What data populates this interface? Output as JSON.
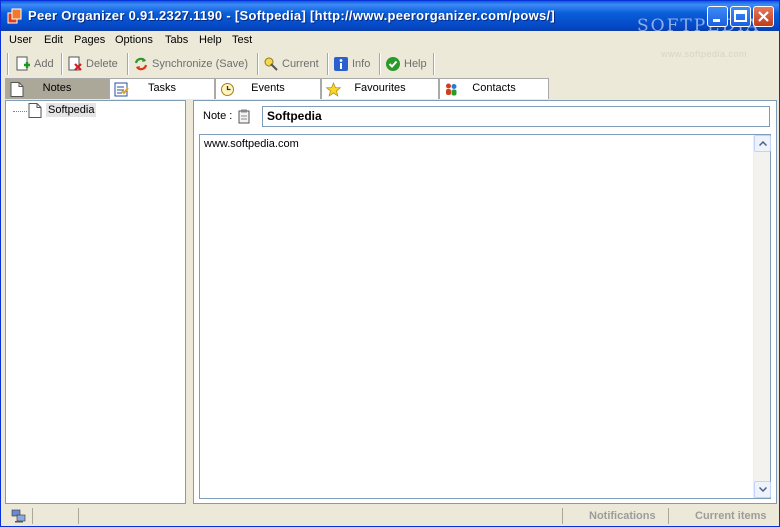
{
  "window": {
    "title": "Peer Organizer 0.91.2327.1190 - [Softpedia] [http://www.peerorganizer.com/pows/]",
    "watermark": "SOFTPEDIA",
    "watermark_sub": "www.softpedia.com",
    "controls": [
      "minimize",
      "maximize",
      "close"
    ]
  },
  "menu": {
    "items": [
      "User",
      "Edit",
      "Pages",
      "Options",
      "Tabs",
      "Help",
      "Test"
    ]
  },
  "toolbar": {
    "add_label": "Add",
    "delete_label": "Delete",
    "sync_label": "Synchronize (Save)",
    "current_label": "Current",
    "info_label": "Info",
    "help_label": "Help"
  },
  "tabs": {
    "items": [
      {
        "label": "Notes",
        "icon": "note-icon",
        "active": true
      },
      {
        "label": "Tasks",
        "icon": "tasks-icon",
        "active": false
      },
      {
        "label": "Events",
        "icon": "clock-icon",
        "active": false
      },
      {
        "label": "Favourites",
        "icon": "star-icon",
        "active": false
      },
      {
        "label": "Contacts",
        "icon": "people-icon",
        "active": false
      }
    ]
  },
  "tree": {
    "items": [
      {
        "label": "Softpedia",
        "icon": "note-icon"
      }
    ]
  },
  "note": {
    "label": "Note :",
    "title_value": "Softpedia",
    "body": "www.softpedia.com"
  },
  "status": {
    "notifications": "Notifications",
    "current_items": "Current items"
  },
  "colors": {
    "titlebar": "#0a5fd8",
    "chrome": "#ece9d8",
    "active_tab": "#aca899",
    "border": "#7f9db9"
  }
}
